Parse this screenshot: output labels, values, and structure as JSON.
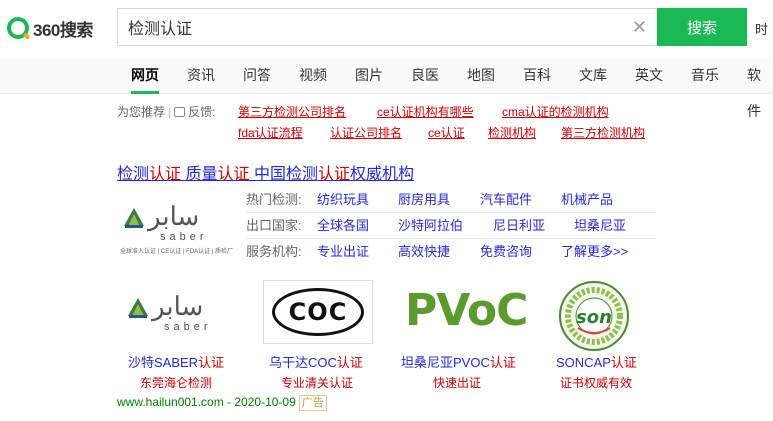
{
  "header": {
    "logo_text": "360搜索",
    "search_value": "检测认证",
    "search_button": "搜索",
    "extra": "时"
  },
  "tabs": [
    "网页",
    "资讯",
    "问答",
    "视频",
    "图片",
    "良医",
    "地图",
    "百科",
    "文库",
    "英文",
    "音乐",
    "软件"
  ],
  "recommend": {
    "label": "为您推荐",
    "feedback": "反馈:",
    "links": [
      "第三方检测公司排名",
      "ce认证机构有哪些",
      "cma认证的检测机构",
      "fda认证流程",
      "认证公司排名",
      "ce认证",
      "检测机构",
      "第三方检测机构"
    ]
  },
  "ad": {
    "title_parts": [
      "检测",
      "认证",
      " 质量",
      "认证",
      " 中国检测",
      "认证",
      "权威机构"
    ],
    "logo": {
      "arabic": "سابر",
      "latin": "saber",
      "sub": "全球准入认证 | CE认证 | FDA认证 | 质检厂"
    },
    "rows": [
      {
        "label": "热门检测:",
        "links": [
          "纺织玩具",
          "厨房用具",
          "汽车配件",
          "机械产品"
        ]
      },
      {
        "label": "出口国家:",
        "links": [
          "全球各国",
          "沙特阿拉伯",
          "尼日利亚",
          "坦桑尼亚"
        ]
      },
      {
        "label": "服务机构:",
        "links": [
          "专业出证",
          "高效快捷",
          "免费咨询",
          "了解更多>>"
        ]
      }
    ],
    "gallery": [
      {
        "title_a": "沙特SABER",
        "title_b": "认证",
        "sub": "东莞海仑检测"
      },
      {
        "title_a": "乌干达COC",
        "title_b": "认证",
        "sub": "专业清关认证"
      },
      {
        "title_a": "坦桑尼亚PVOC",
        "title_b": "认证",
        "sub": "快速出证"
      },
      {
        "title_a": "SONCAP",
        "title_b": "认证",
        "sub": "证书权威有效"
      }
    ],
    "coc_text": "COC",
    "pvoc_text": "PVoC",
    "son_text": "son",
    "url": "www.hailun001.com - 2020-10-09",
    "ad_tag": "广告"
  },
  "colors": {
    "brand_green": "#19b955",
    "link_blue": "#2529d8",
    "highlight_red": "#cc0000"
  }
}
